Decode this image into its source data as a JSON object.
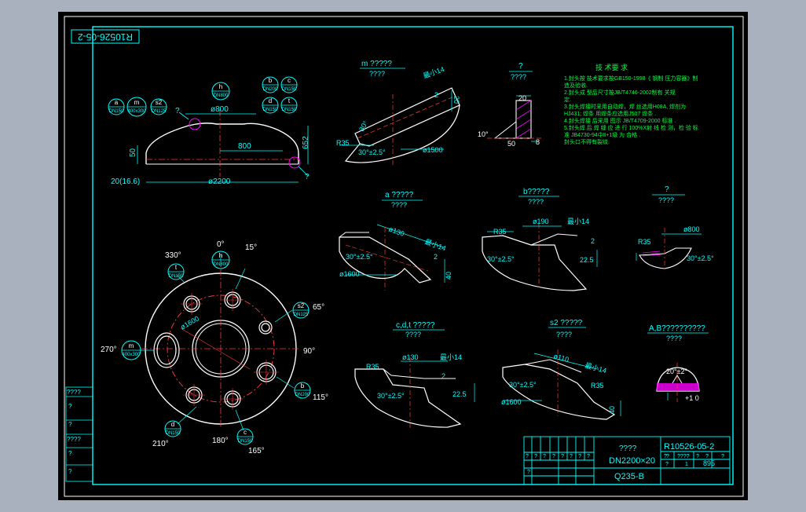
{
  "colors": {
    "frame_bg": "#a9b1bf",
    "sheet_bg": "#000000",
    "border": "#ffffff",
    "dim": "#00ffff",
    "outline": "#ffffff",
    "center": "#ff3b3b",
    "note": "#00ff40",
    "balloon": "#00ffff",
    "hatch": "#ff00ff",
    "yellow": "#ffff00"
  },
  "drawing": {
    "code_rotated": "R10526-05-2",
    "main_view": {
      "dim_800_top": "ø800",
      "dim_800": "800",
      "dim_2200": "ø2200",
      "dim_652": "652",
      "dim_50": "50",
      "dim_thk": "20(16.6)",
      "q_left": "?",
      "q_right": "?",
      "balloons": {
        "a": {
          "top": "a",
          "bottom": "DN150"
        },
        "m": {
          "top": "m",
          "bottom": "400x300"
        },
        "s2": {
          "top": "s2",
          "bottom": "DN125"
        },
        "h": {
          "top": "h",
          "bottom": "DN800"
        },
        "b": {
          "top": "b",
          "bottom": "DN200"
        },
        "c": {
          "top": "c",
          "bottom": "DN150"
        },
        "d": {
          "top": "d",
          "bottom": "DN150"
        },
        "t": {
          "top": "t",
          "bottom": "DN150"
        }
      }
    },
    "plan_view": {
      "angles": [
        "0°",
        "15°",
        "330°",
        "65°",
        "270°",
        "90°",
        "115°",
        "210°",
        "180°",
        "165°"
      ],
      "dim_bolt": "ø1600",
      "balloons": {
        "h": {
          "top": "h",
          "bottom": "DN800"
        },
        "t": {
          "top": "t",
          "bottom": "DN150"
        },
        "s2": {
          "top": "s2",
          "bottom": "DN125"
        },
        "m": {
          "top": "m",
          "bottom": "400x300"
        },
        "b": {
          "top": "b",
          "bottom": "DN200"
        },
        "d": {
          "top": "d",
          "bottom": "DN150"
        },
        "c": {
          "top": "c",
          "bottom": "DN150"
        }
      }
    },
    "details": {
      "m": {
        "title": "m ?????",
        "sub": "????",
        "dims": [
          "最小14",
          "20",
          "2",
          "30°",
          "R35",
          "30°±2.5°",
          "ø1500"
        ]
      },
      "q": {
        "title": "?",
        "sub": "????",
        "dims": [
          "20",
          "10°",
          "8",
          "50"
        ]
      },
      "a": {
        "title": "a ?????",
        "sub": "????",
        "dims": [
          "ø130",
          "最小14",
          "2",
          "30°±2.5°",
          "ø1600",
          "40"
        ]
      },
      "b": {
        "title": "b?????",
        "sub": "????",
        "dims": [
          "ø190",
          "最小14",
          "R35",
          "30°±2.5°",
          "2",
          "22.5"
        ]
      },
      "top": {
        "title": "?",
        "sub": "????",
        "dims": [
          "ø800",
          "R35",
          "30°±2.5°"
        ]
      },
      "cdt": {
        "title": "c,d,t ?????",
        "sub": "????",
        "dims": [
          "ø130",
          "最小14",
          "R35",
          "2",
          "30°±2.5°",
          "22.5"
        ]
      },
      "s2": {
        "title": "s2 ?????",
        "sub": "????",
        "dims": [
          "ø110",
          "最小14",
          "30°±2.5°",
          "R35",
          "ø1600",
          "40"
        ]
      },
      "ab": {
        "title": "A,B??????????",
        "sub": "????",
        "dims": [
          "20°±2°",
          "+1 0"
        ]
      }
    },
    "notes": {
      "title": "技 术要 求",
      "lines": [
        "1.封头按 技术要求按GB150-1998《  钢制  压力容器》制",
        "    造及验收.",
        "2.封头成 型后尺寸按JB/T4746-2002制有    关规",
        "    定.",
        "3.封头焊接时采用自动焊，焊 丝选用H08A, 焊剂为",
        "    HJ431;  焊条 用焊条应选用J507    焊条 .",
        "4.封头焊接 后采用 图示 JB/T4709-2000     标准 .",
        "5.封头焊 后 焊 缝 应 进 行 100%X射  线 检 测，检 验 标",
        "    准 JB4730-94中Ⅱ+1级      为 合格 .",
        "    封头口不得有裂纹."
      ]
    },
    "title_block": {
      "name": "????",
      "spec": "DN2200×20",
      "material": "Q235-B",
      "code": "R10526-05-2",
      "row_cells": [
        "?",
        "?",
        "????",
        "?",
        "?",
        "?"
      ],
      "row_vals": [
        "?",
        "1",
        "895"
      ],
      "rev_headers": [
        "?",
        "?",
        "?",
        "?",
        "?",
        "?",
        "?",
        "?",
        "?"
      ]
    },
    "left_panel": [
      "????",
      "?",
      "?",
      "????",
      "?",
      "?"
    ]
  }
}
